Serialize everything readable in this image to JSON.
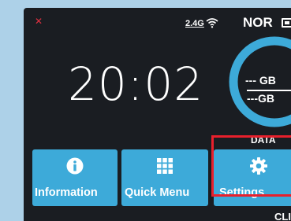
{
  "status": {
    "band": "2.4G",
    "mode": "NOR",
    "sim_icon": "close-icon",
    "wifi_icon": "wifi-icon",
    "battery_icon": "battery-icon"
  },
  "clock": "20:02",
  "data": {
    "used": "--- GB",
    "total": "---GB",
    "label": "DATA",
    "ring_color": "#3daad9"
  },
  "tiles": [
    {
      "label": "Information",
      "icon": "info-icon"
    },
    {
      "label": "Quick Menu",
      "icon": "grid-icon"
    },
    {
      "label": "Settings",
      "icon": "gear-icon"
    }
  ],
  "bottom_text": "CLI",
  "colors": {
    "accent": "#3daad9",
    "highlight": "#e8202c",
    "screen_bg": "#1a1d22"
  }
}
